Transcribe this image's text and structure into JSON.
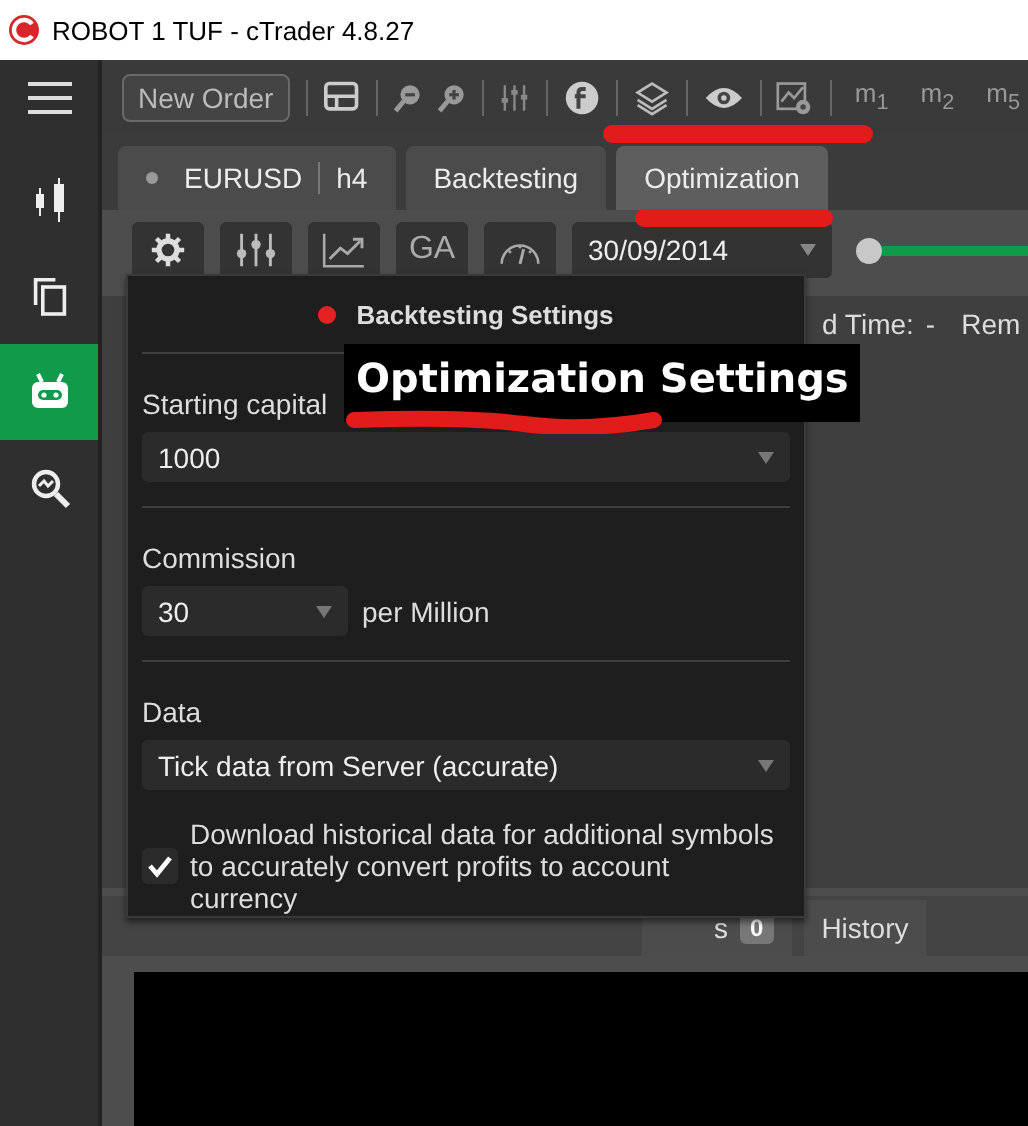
{
  "window": {
    "title": "ROBOT 1 TUF - cTrader 4.8.27"
  },
  "sidebar": {
    "items": [
      {
        "kind": "chart",
        "selected": false
      },
      {
        "kind": "copy",
        "selected": false
      },
      {
        "kind": "robot",
        "selected": true
      },
      {
        "kind": "analyze",
        "selected": false
      }
    ]
  },
  "toolbar": {
    "new_order": "New Order",
    "timeframes": [
      "m$_{1}$",
      "m$_{2}$",
      "m$_{5}$"
    ]
  },
  "tabs": [
    {
      "kind": "symbol",
      "label": "EURUSD",
      "timeframe": "h4",
      "selected": false
    },
    {
      "kind": "plain",
      "label": "Backtesting",
      "selected": false
    },
    {
      "kind": "plain",
      "label": "Optimization",
      "selected": true
    }
  ],
  "controls": {
    "ga": "GA",
    "date": "30/09/2014",
    "range": {
      "level": 0
    }
  },
  "popup": {
    "title": "Backtesting Settings",
    "starting_capital": {
      "label": "Starting capital",
      "value": "1000"
    },
    "commission": {
      "label": "Commission",
      "value": "30",
      "unit": "per Million"
    },
    "data": {
      "label": "Data",
      "value": "Tick data from Server (accurate)"
    },
    "download": {
      "label": "Download historical data for additional symbols to accurately convert profits to account currency",
      "checked": true
    }
  },
  "background": {
    "time_label": "d Time:",
    "time_value": "-",
    "remaining": "Rem",
    "bottom_tabs": [
      {
        "label": "s",
        "badge": "0"
      },
      {
        "label": "History"
      }
    ]
  },
  "annotation": {
    "text": "Optimization Settings"
  }
}
